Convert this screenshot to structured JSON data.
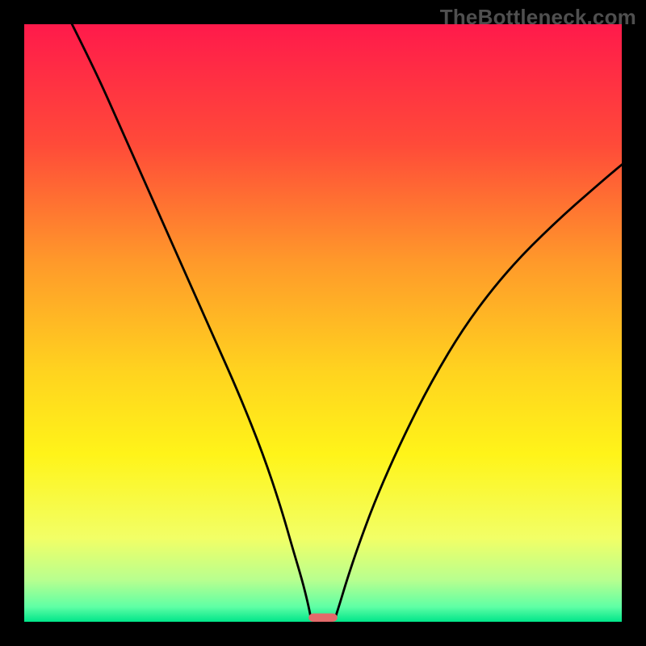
{
  "watermark": "TheBottleneck.com",
  "chart_data": {
    "type": "line",
    "title": "",
    "xlabel": "",
    "ylabel": "",
    "xlim": [
      0,
      100
    ],
    "ylim": [
      0,
      100
    ],
    "grid": false,
    "legend": false,
    "background_gradient_stops": [
      {
        "offset": 0.0,
        "color": "#ff1a4b"
      },
      {
        "offset": 0.2,
        "color": "#ff4a39"
      },
      {
        "offset": 0.4,
        "color": "#ff9a2a"
      },
      {
        "offset": 0.58,
        "color": "#ffd31f"
      },
      {
        "offset": 0.72,
        "color": "#fff419"
      },
      {
        "offset": 0.86,
        "color": "#f2ff66"
      },
      {
        "offset": 0.93,
        "color": "#b8ff8f"
      },
      {
        "offset": 0.975,
        "color": "#5fffa5"
      },
      {
        "offset": 1.0,
        "color": "#00e58a"
      }
    ],
    "series": [
      {
        "name": "left-branch",
        "x": [
          8,
          12,
          16,
          20,
          24,
          28,
          32,
          36,
          40,
          43,
          45,
          46.5,
          47.5,
          48.0
        ],
        "y": [
          100,
          92,
          83,
          74,
          65,
          56,
          47,
          38,
          28,
          19,
          12,
          7,
          3,
          0.5
        ]
      },
      {
        "name": "right-branch",
        "x": [
          52.0,
          52.8,
          54,
          56,
          59,
          63,
          68,
          74,
          81,
          89,
          97,
          100
        ],
        "y": [
          0.5,
          3,
          7,
          13,
          21,
          30,
          40,
          50,
          59,
          67,
          74,
          76.5
        ]
      }
    ],
    "marker": {
      "name": "minimum-marker",
      "x_center": 50,
      "y": 0.7,
      "width": 4.8,
      "height": 1.4,
      "color": "#e36a6a",
      "rx": 0.8
    }
  }
}
